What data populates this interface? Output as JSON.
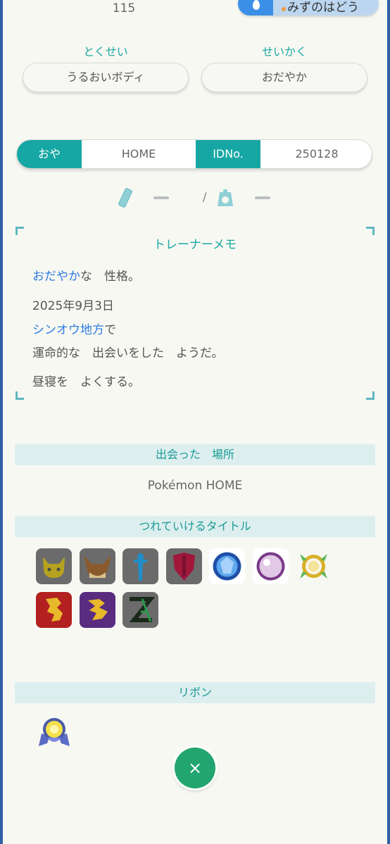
{
  "stats": {
    "value_top": "115"
  },
  "move": {
    "name": "みずのはどう",
    "type_icon": "water-drop-icon",
    "type_color": "#3b8fe6"
  },
  "ability": {
    "label": "とくせい",
    "value": "うるおいボディ"
  },
  "nature": {
    "label": "せいかく",
    "value": "おだやか"
  },
  "owner_bar": {
    "ot_label": "おや",
    "ot_value": "HOME",
    "id_label": "IDNo.",
    "id_value": "250128"
  },
  "size_row": {
    "height_value": "ー",
    "separator": "/",
    "weight_value": "ー"
  },
  "trainer_memo": {
    "title": "トレーナーメモ",
    "nature_word": "おだやか",
    "nature_rest": "な　性格。",
    "date": "2025年9月3日",
    "region_word": "シンオウ地方",
    "region_rest": "で",
    "meet_line": "運命的な　出会いをした　ようだ。",
    "trait_line": "昼寝を　よくする。"
  },
  "met_location": {
    "header": "出会った　場所",
    "value": "Pokémon HOME"
  },
  "titles": {
    "header": "つれていけるタイトル",
    "icons": [
      "pikachu-mark-icon",
      "eevee-mark-icon",
      "sword-mark-icon",
      "shield-mark-icon",
      "diamond-gem-icon",
      "pearl-gem-icon",
      "legends-arceus-mark-icon",
      "koraidon-mark-icon",
      "miraidon-mark-icon",
      "z-a-mark-icon"
    ]
  },
  "ribbons": {
    "header": "リボン",
    "icons": [
      "ribbon-badge-icon"
    ]
  },
  "close_button": {
    "label": "×"
  },
  "colors": {
    "accent": "#1aa7a3",
    "close": "#22a56e",
    "link": "#2c7be0"
  }
}
